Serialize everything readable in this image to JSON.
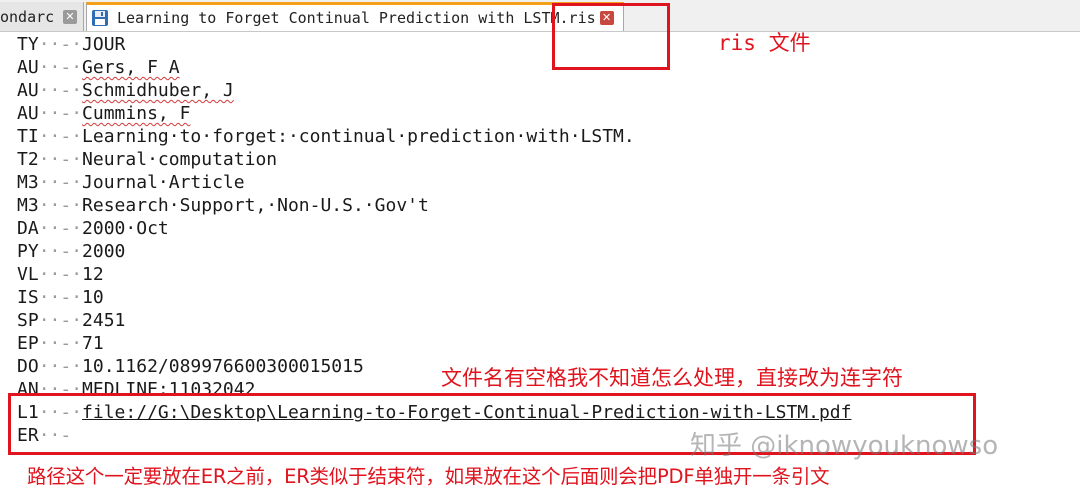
{
  "tabs": [
    {
      "label": "ondarc",
      "active": false
    },
    {
      "label": "Learning to Forget Continual Prediction with LSTM.ris",
      "active": true
    }
  ],
  "icons": {
    "tab_close": "close-icon",
    "tab_save": "floppy-disk-icon"
  },
  "colors": {
    "annotation": "#e0141e",
    "active_tab_accent": "#f5a01a"
  },
  "editor": {
    "lines": [
      {
        "tag": "TY",
        "sep": "··-·",
        "value": "JOUR"
      },
      {
        "tag": "AU",
        "sep": "··-·",
        "value": "Gers, F A"
      },
      {
        "tag": "AU",
        "sep": "··-·",
        "value": "Schmidhuber, J"
      },
      {
        "tag": "AU",
        "sep": "··-·",
        "value": "Cummins, F"
      },
      {
        "tag": "TI",
        "sep": "··-·",
        "value": "Learning·to·forget:·continual·prediction·with·LSTM."
      },
      {
        "tag": "T2",
        "sep": "··-·",
        "value": "Neural·computation"
      },
      {
        "tag": "M3",
        "sep": "··-·",
        "value": "Journal·Article"
      },
      {
        "tag": "M3",
        "sep": "··-·",
        "value": "Research·Support,·Non-U.S.·Gov't"
      },
      {
        "tag": "DA",
        "sep": "··-·",
        "value": "2000·Oct"
      },
      {
        "tag": "PY",
        "sep": "··-·",
        "value": "2000"
      },
      {
        "tag": "VL",
        "sep": "··-·",
        "value": "12"
      },
      {
        "tag": "IS",
        "sep": "··-·",
        "value": "10"
      },
      {
        "tag": "SP",
        "sep": "··-·",
        "value": "2451"
      },
      {
        "tag": "EP",
        "sep": "··-·",
        "value": "71"
      },
      {
        "tag": "DO",
        "sep": "··-·",
        "value": "10.1162/089976600300015015"
      },
      {
        "tag": "AN",
        "sep": "··-·",
        "value": "MEDLINE:11032042"
      },
      {
        "tag": "L1",
        "sep": "··-·",
        "value": "file://G:\\Desktop\\Learning-to-Forget-Continual-Prediction-with-LSTM.pdf"
      },
      {
        "tag": "ER",
        "sep": "··-",
        "value": ""
      }
    ]
  },
  "annotations": {
    "ris_note": "ris 文件",
    "filename_note": "文件名有空格我不知道怎么处理，直接改为连字符",
    "path_note": "路径这个一定要放在ER之前，ER类似于结束符，如果放在这个后面则会把PDF单独开一条引文"
  },
  "watermark": "知乎 @iknowyouknowso"
}
